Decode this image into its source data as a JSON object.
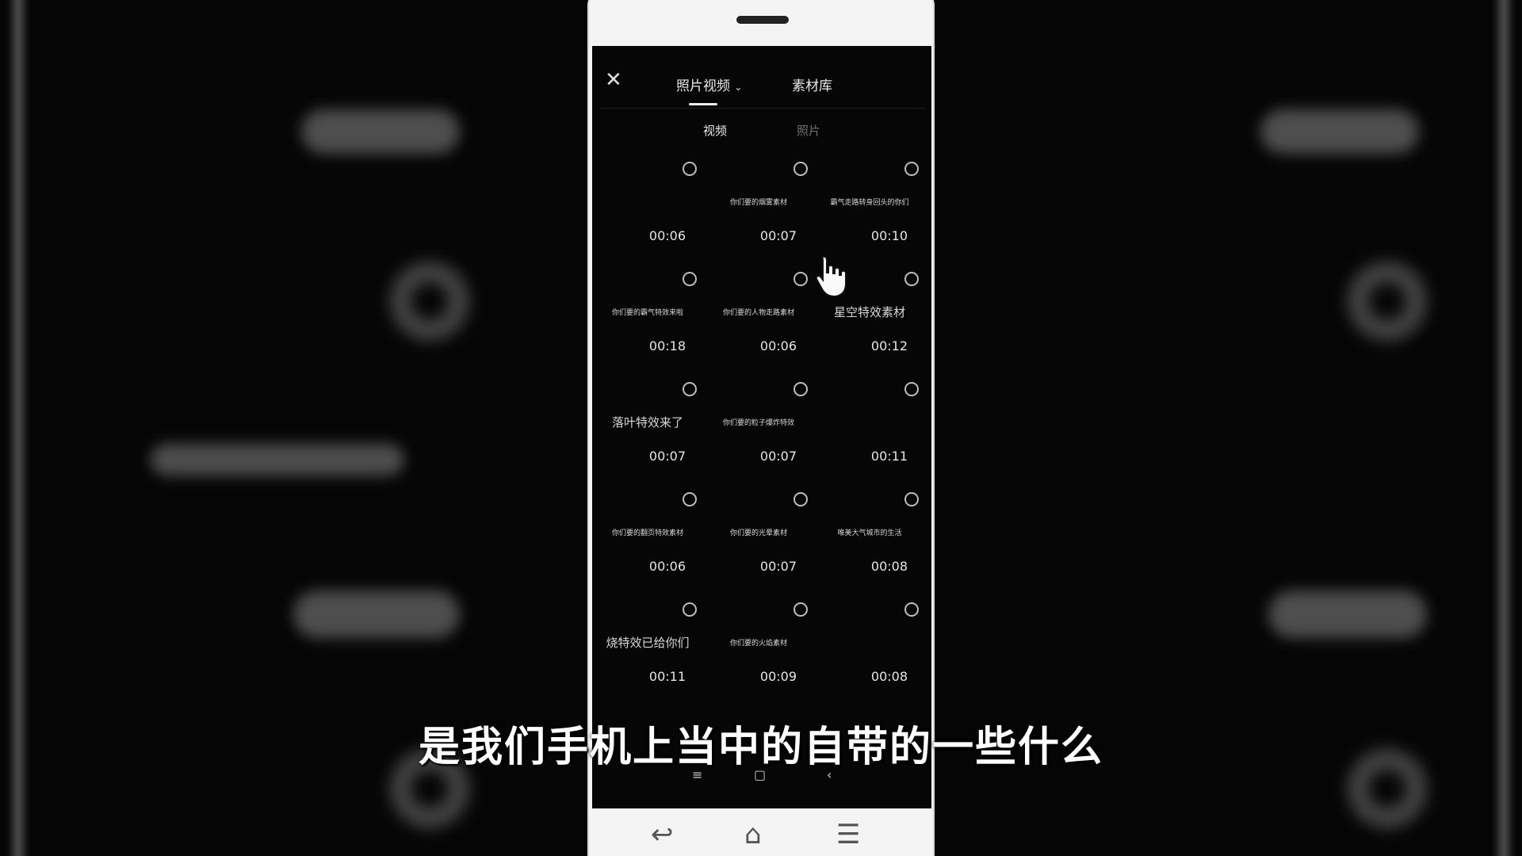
{
  "header": {
    "close_icon": "close-icon",
    "tab_media": "照片视频",
    "tab_media_chevron": "⌄",
    "tab_library": "素材库"
  },
  "subtabs": {
    "video": "视频",
    "photo": "照片"
  },
  "grid": {
    "items": [
      {
        "caption": "",
        "duration": "00:06"
      },
      {
        "caption": "你们要的烟雾素材",
        "duration": "00:07"
      },
      {
        "caption": "霸气走路转身回头的你们",
        "duration": "00:10"
      },
      {
        "caption": "你们要的霸气特效来啦",
        "duration": "00:18"
      },
      {
        "caption": "你们要的人物走路素材",
        "duration": "00:06"
      },
      {
        "caption": "星空特效素材",
        "duration": "00:12"
      },
      {
        "caption": "落叶特效来了",
        "duration": "00:07"
      },
      {
        "caption": "你们要的粒子爆炸特效",
        "duration": "00:07"
      },
      {
        "caption": "",
        "duration": "00:11"
      },
      {
        "caption": "你们要的翻页特效素材",
        "duration": "00:06"
      },
      {
        "caption": "你们要的光晕素材",
        "duration": "00:07"
      },
      {
        "caption": "唯美大气城市的生活",
        "duration": "00:08"
      },
      {
        "caption": "烧特效已给你们",
        "duration": "00:11"
      },
      {
        "caption": "你们要的火焰素材",
        "duration": "00:09"
      },
      {
        "caption": "",
        "duration": "00:08"
      }
    ]
  },
  "system_nav": {
    "menu_icon": "≡",
    "home_icon": "▢",
    "back_icon": "‹"
  },
  "subtitle": "是我们手机上当中的自带的一些什么",
  "colors": {
    "screen_bg": "#060606",
    "phone_body": "#f4f4f4",
    "subtitle_text": "#ffffff"
  }
}
